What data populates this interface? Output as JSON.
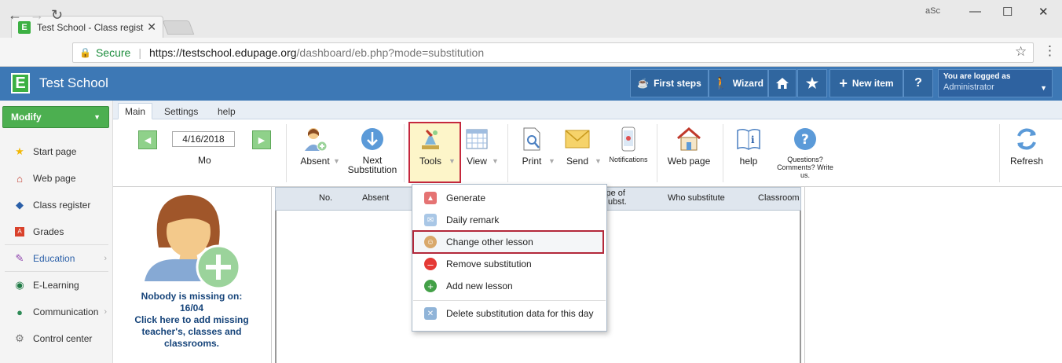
{
  "browser": {
    "tab_title": "Test School - Class regist",
    "tab_favicon": "E",
    "user_badge": "aSc",
    "secure_label": "Secure",
    "url_main": "https://testschool.edupage.org",
    "url_path": "/dashboard/eb.php?mode=substitution"
  },
  "header": {
    "logo": "E",
    "title": "Test School",
    "first_steps": "First steps",
    "wizard": "Wizard",
    "new_item": "New item",
    "help": "?",
    "logged_in_as": "You are logged as",
    "user": "Administrator"
  },
  "sidebar": {
    "modify": "Modify",
    "items": [
      {
        "label": "Start page",
        "icon": "star-icon"
      },
      {
        "label": "Web page",
        "icon": "house-icon"
      },
      {
        "label": "Class register",
        "icon": "book-icon"
      },
      {
        "label": "Grades",
        "icon": "grade-icon"
      },
      {
        "label": "Education",
        "icon": "education-icon"
      },
      {
        "label": "E-Learning",
        "icon": "elearning-icon"
      },
      {
        "label": "Communication",
        "icon": "communication-icon"
      },
      {
        "label": "Control center",
        "icon": "gear-icon"
      }
    ]
  },
  "ribbon": {
    "tabs": [
      "Main",
      "Settings",
      "help"
    ],
    "date": "4/16/2018",
    "day": "Mo",
    "absent": "Absent",
    "next_sub_1": "Next",
    "next_sub_2": "Substitution",
    "tools": "Tools",
    "view": "View",
    "print": "Print",
    "send": "Send",
    "notifications": "Notifications",
    "web_page": "Web page",
    "help": "help",
    "questions_1": "Questions?",
    "questions_2": "Comments? Write",
    "questions_3": "us.",
    "refresh": "Refresh"
  },
  "grid": {
    "headers": [
      "No.",
      "Absent",
      "ype of",
      "ubst.",
      "Who substitute",
      "Classroom"
    ]
  },
  "missing": {
    "line1": "Nobody is missing on:",
    "line2": "16/04",
    "line3": "Click here to add missing",
    "line4": "teacher's, classes and",
    "line5": "classrooms."
  },
  "tools_menu": {
    "items": [
      {
        "label": "Generate",
        "icon": "generate-icon"
      },
      {
        "label": "Daily remark",
        "icon": "remark-icon"
      },
      {
        "label": "Change other lesson",
        "icon": "change-lesson-icon"
      },
      {
        "label": "Remove substitution",
        "icon": "remove-icon"
      },
      {
        "label": "Add new lesson",
        "icon": "add-icon"
      },
      {
        "label": "Delete substitution data for this day",
        "icon": "delete-icon"
      }
    ]
  },
  "colors": {
    "header_blue": "#3d78b5",
    "edupage_green": "#3cb043",
    "highlight_red": "#c5283d",
    "missing_text": "#16447a"
  }
}
